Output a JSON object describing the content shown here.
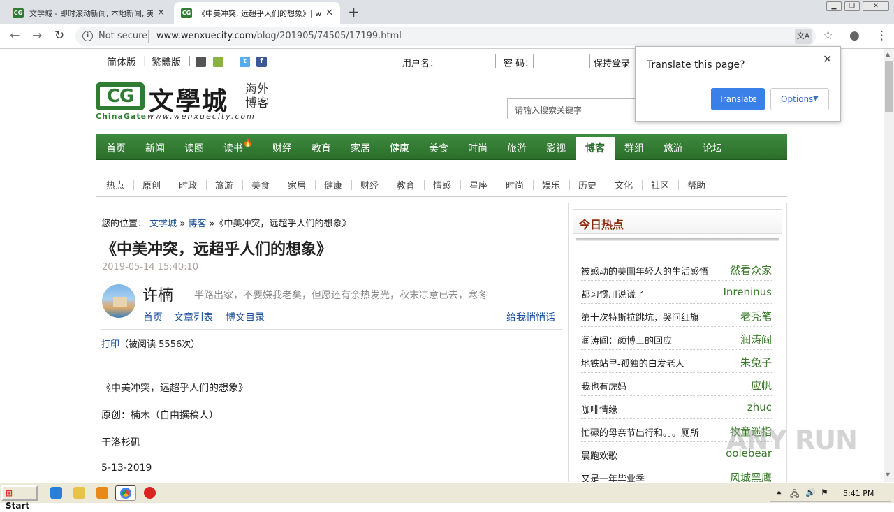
{
  "browser": {
    "tabs": [
      {
        "favicon": "CG",
        "title": "文学城 - 即时滚动新闻, 本地新闻, 美",
        "close": "✕"
      },
      {
        "favicon": "CG",
        "title": "《中美冲突, 远超乎人们的想象》| wo",
        "close": "✕"
      }
    ],
    "new_tab": "+",
    "window_controls": [
      "▁",
      "❐",
      "✕"
    ],
    "nav": {
      "back": "←",
      "forward": "→",
      "reload": "↻"
    },
    "omnibox": {
      "security": "Not secure",
      "host": "www.wenxuecity.com",
      "path": "/blog/201905/74505/17199.html"
    },
    "translate_icon": "文A",
    "bookmark_icon": "☆",
    "account_icon": "●",
    "menu_icon": "⋮"
  },
  "translate_popup": {
    "question": "Translate this page?",
    "close": "✕",
    "translate_label": "Translate",
    "options_label": "Options"
  },
  "site": {
    "langs": [
      "简体版",
      "繁體版"
    ],
    "social": [
      "",
      "",
      "t",
      "f"
    ],
    "login": {
      "user_label": "用户名：",
      "pass_label": "密 码：",
      "remember": "保持登录"
    },
    "logo": {
      "mark": "CG",
      "name": "文學城",
      "sub": "海外 博客",
      "brand_en": "ChinaGate",
      "domain": "www.wenxuecity.com"
    },
    "search_placeholder": "请输入搜索关键字",
    "main_nav": [
      "首页",
      "新闻",
      "读图",
      "读书",
      "财经",
      "教育",
      "家居",
      "健康",
      "美食",
      "时尚",
      "旅游",
      "影视",
      "博客",
      "群组",
      "悠游",
      "论坛"
    ],
    "main_nav_active": "博客",
    "sub_nav": [
      "热点",
      "原创",
      "时政",
      "旅游",
      "美食",
      "家居",
      "健康",
      "财经",
      "教育",
      "情感",
      "星座",
      "时尚",
      "娱乐",
      "历史",
      "文化",
      "社区",
      "帮助"
    ]
  },
  "article": {
    "crumb_label": "您的位置：",
    "crumb_home": "文学城",
    "crumb_sep": "»",
    "crumb_blog": "博客",
    "crumb_title": "《中美冲突，远超乎人们的想象》",
    "title": "《中美冲突，远超乎人们的想象》",
    "date": "2019-05-14 15:40:10",
    "author": "许楠",
    "slogan": "半路出家，不要嫌我老矣，但愿还有余热发光，秋末凉意已去，寒冬",
    "author_links": [
      "首页",
      "文章列表",
      "博文目录"
    ],
    "message_link": "给我悄悄话",
    "print_label": "打印",
    "read_count": "（被阅读 5556次）",
    "paragraphs": [
      "《中美冲突，远超乎人们的想象》",
      "原创：楠木（自由撰稿人）",
      "于洛杉矶",
      "5-13-2019"
    ]
  },
  "hot": {
    "heading": "今日热点",
    "items": [
      {
        "title": "被感动的美国年轻人的生活感悟",
        "author": "然看众家"
      },
      {
        "title": "都习惯川说谎了",
        "author": "Inreninus"
      },
      {
        "title": "第十次特斯拉跳坑，哭问红旗",
        "author": "老秃笔"
      },
      {
        "title": "润涛阎：颜博士的回应",
        "author": "润涛阎"
      },
      {
        "title": "地铁站里-孤独的白发老人",
        "author": "朱兔子"
      },
      {
        "title": "我也有虎妈",
        "author": "应帆"
      },
      {
        "title": "咖啡情缘",
        "author": "zhuc"
      },
      {
        "title": "忙碌的母亲节出行和。。。厕所",
        "author": "牧童遥指"
      },
      {
        "title": "晨跑欢歌",
        "author": "oolebear"
      },
      {
        "title": "又是一年毕业季",
        "author": "风城黑鹰"
      }
    ]
  },
  "taskbar": {
    "start": "Start",
    "clock": "5:41 PM"
  },
  "watermark": "ANY RUN"
}
